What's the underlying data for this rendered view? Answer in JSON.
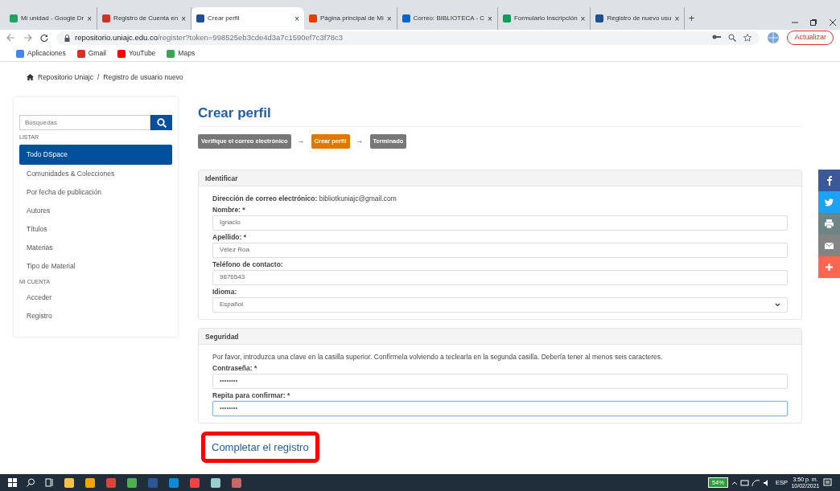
{
  "browser": {
    "tabs": [
      {
        "title": "Mi unidad - Google Dr",
        "selected": false,
        "color": "#1fa463"
      },
      {
        "title": "Registro de Cuenta en",
        "selected": false,
        "color": "#d93025"
      },
      {
        "title": "Crear perfil",
        "selected": true,
        "color": "#1d4f91"
      },
      {
        "title": "Página principal de Mi",
        "selected": false,
        "color": "#eb3c00"
      },
      {
        "title": "Correo: BIBLIOTECA - C",
        "selected": false,
        "color": "#0a64c8"
      },
      {
        "title": "Formulario Inscripción",
        "selected": false,
        "color": "#0f9d58"
      },
      {
        "title": "Registro de nuevo usu",
        "selected": false,
        "color": "#1d4f91"
      }
    ],
    "tab_close": "×",
    "new_tab": "+",
    "url_host": "repositorio.uniajc.edu.co",
    "url_path": "/register?token=998525eb3cde4d3a7c1590ef7c3f78c3",
    "update_button": "Actualizar",
    "bookmarks": [
      {
        "label": "Aplicaciones",
        "color": "#4285f4"
      },
      {
        "label": "Gmail",
        "color": "#d93025"
      },
      {
        "label": "YouTube",
        "color": "#ff0000"
      },
      {
        "label": "Maps",
        "color": "#34a853"
      }
    ]
  },
  "breadcrumb_separator": "/",
  "breadcrumb": [
    {
      "label": "Repositorio Uniajc"
    },
    {
      "label": "Registro de usuario nuevo"
    }
  ],
  "sidebar": {
    "search_placeholder": "Búsquedas",
    "sections": [
      {
        "heading": "LISTAR",
        "items": [
          {
            "label": "Todo DSpace",
            "selected": true
          },
          {
            "label": "Comunidades & Colecciones",
            "selected": false
          },
          {
            "label": "Por fecha de publicación",
            "selected": false
          },
          {
            "label": "Autores",
            "selected": false
          },
          {
            "label": "Títulos",
            "selected": false
          },
          {
            "label": "Materias",
            "selected": false
          },
          {
            "label": "Tipo de Material",
            "selected": false
          }
        ]
      },
      {
        "heading": "MI CUENTA",
        "items": [
          {
            "label": "Acceder",
            "selected": false
          },
          {
            "label": "Registro",
            "selected": false
          }
        ]
      }
    ]
  },
  "title": "Crear perfil",
  "steps": [
    {
      "label": "Verifique el correo electrónico",
      "selected": false
    },
    {
      "label": "Crear perfil",
      "selected": true
    },
    {
      "label": "Terminado",
      "selected": false
    }
  ],
  "step_arrow": "→",
  "panels": [
    {
      "heading": "Identificar",
      "intro": "**Dirección de correo electrónico:** bibliotkuniajc@gmail.com",
      "fields": [
        {
          "label": "Nombre: *",
          "value": "Ignacio",
          "kind": "text",
          "focused": false
        },
        {
          "label": "Apellido: *",
          "value": "Vélez Roa",
          "kind": "text",
          "focused": false
        },
        {
          "label": "Teléfono de contacto:",
          "value": "9876543",
          "kind": "text",
          "focused": false
        },
        {
          "label": "Idioma:",
          "value": "Español",
          "kind": "select",
          "focused": false
        }
      ]
    },
    {
      "heading": "Seguridad",
      "intro": "Por favor, introduzca una clave en la casilla superior. Confírmela volviendo a teclearla en la segunda casilla. Debería tener al menos seis caracteres.",
      "fields": [
        {
          "label": "Contraseña: *",
          "value": "••••••••",
          "kind": "text",
          "focused": false
        },
        {
          "label": "Repita para confirmar: *",
          "value": "••••••••",
          "kind": "text",
          "focused": true
        }
      ]
    }
  ],
  "submit": {
    "label": "Completar el registro",
    "highlighted": true
  },
  "share": [
    {
      "kind": "facebook",
      "color": "#3b5998"
    },
    {
      "kind": "twitter",
      "color": "#1da1f2"
    },
    {
      "kind": "print",
      "color": "#6d8585"
    },
    {
      "kind": "email",
      "color": "#848484"
    },
    {
      "kind": "more",
      "color": "#ff6550"
    }
  ],
  "taskbar": {
    "battery": "54%",
    "language": "ESP",
    "time": "3:50 p. m.",
    "date": "10/02/2021"
  }
}
